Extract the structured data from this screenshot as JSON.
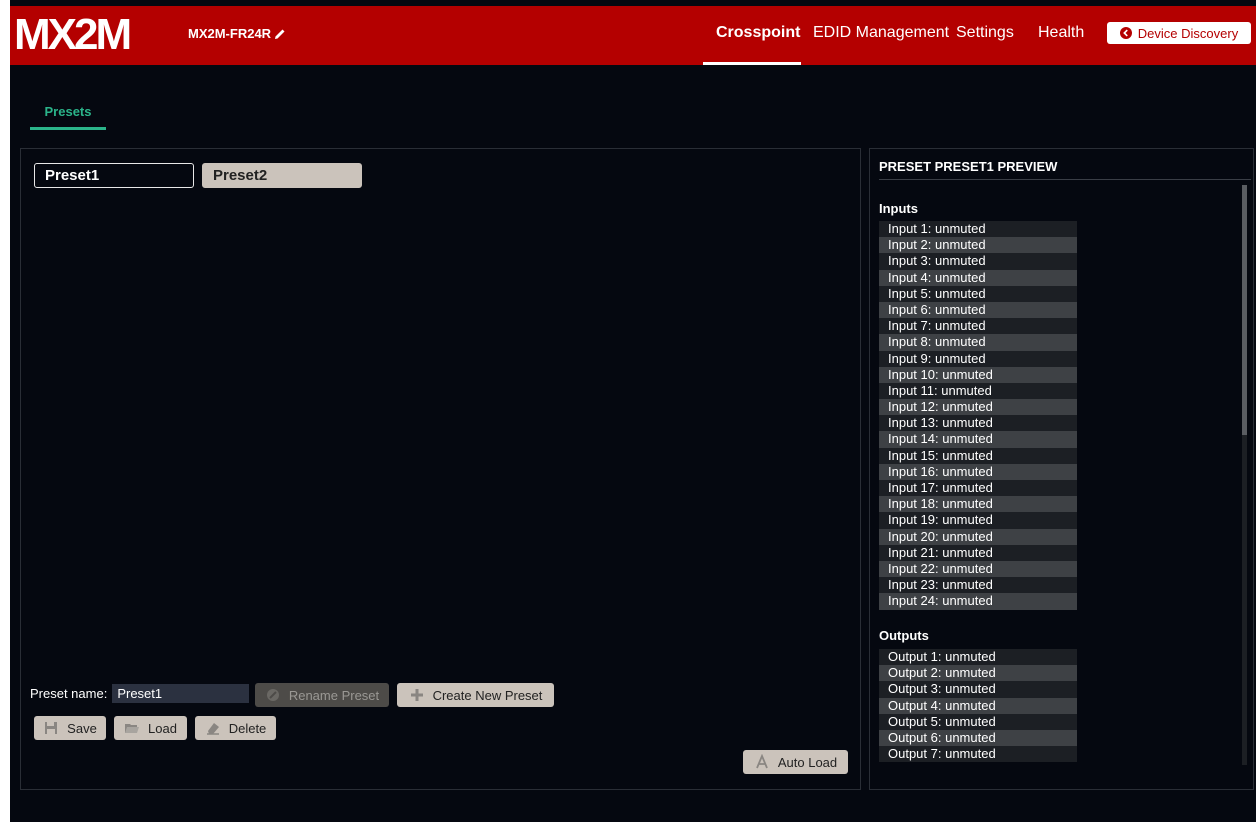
{
  "header": {
    "logo_text": "MX2M",
    "device_name": "MX2M-FR24R",
    "nav": [
      {
        "label": "Crosspoint",
        "active": true
      },
      {
        "label": "EDID Management",
        "active": false
      },
      {
        "label": "Settings",
        "active": false
      },
      {
        "label": "Health",
        "active": false
      }
    ],
    "device_discovery_label": "Device Discovery"
  },
  "tabs": {
    "presets_label": "Presets"
  },
  "presets": {
    "chips": [
      {
        "label": "Preset1",
        "active": true
      },
      {
        "label": "Preset2",
        "active": false
      }
    ],
    "preset_name_label": "Preset name:",
    "preset_name_value": "Preset1",
    "rename_label": "Rename Preset",
    "create_label": "Create New Preset",
    "save_label": "Save",
    "load_label": "Load",
    "delete_label": "Delete",
    "autoload_label": "Auto Load"
  },
  "preview": {
    "title": "PRESET PRESET1 PREVIEW",
    "inputs_label": "Inputs",
    "inputs": [
      "Input 1: unmuted",
      "Input 2: unmuted",
      "Input 3: unmuted",
      "Input 4: unmuted",
      "Input 5: unmuted",
      "Input 6: unmuted",
      "Input 7: unmuted",
      "Input 8: unmuted",
      "Input 9: unmuted",
      "Input 10: unmuted",
      "Input 11: unmuted",
      "Input 12: unmuted",
      "Input 13: unmuted",
      "Input 14: unmuted",
      "Input 15: unmuted",
      "Input 16: unmuted",
      "Input 17: unmuted",
      "Input 18: unmuted",
      "Input 19: unmuted",
      "Input 20: unmuted",
      "Input 21: unmuted",
      "Input 22: unmuted",
      "Input 23: unmuted",
      "Input 24: unmuted"
    ],
    "outputs_label": "Outputs",
    "outputs": [
      "Output 1: unmuted",
      "Output 2: unmuted",
      "Output 3: unmuted",
      "Output 4: unmuted",
      "Output 5: unmuted",
      "Output 6: unmuted",
      "Output 7: unmuted"
    ]
  },
  "colors": {
    "brand_red": "#b40000",
    "accent_green": "#2bb48a",
    "background": "#050810",
    "button_beige": "#cbc3bb"
  }
}
